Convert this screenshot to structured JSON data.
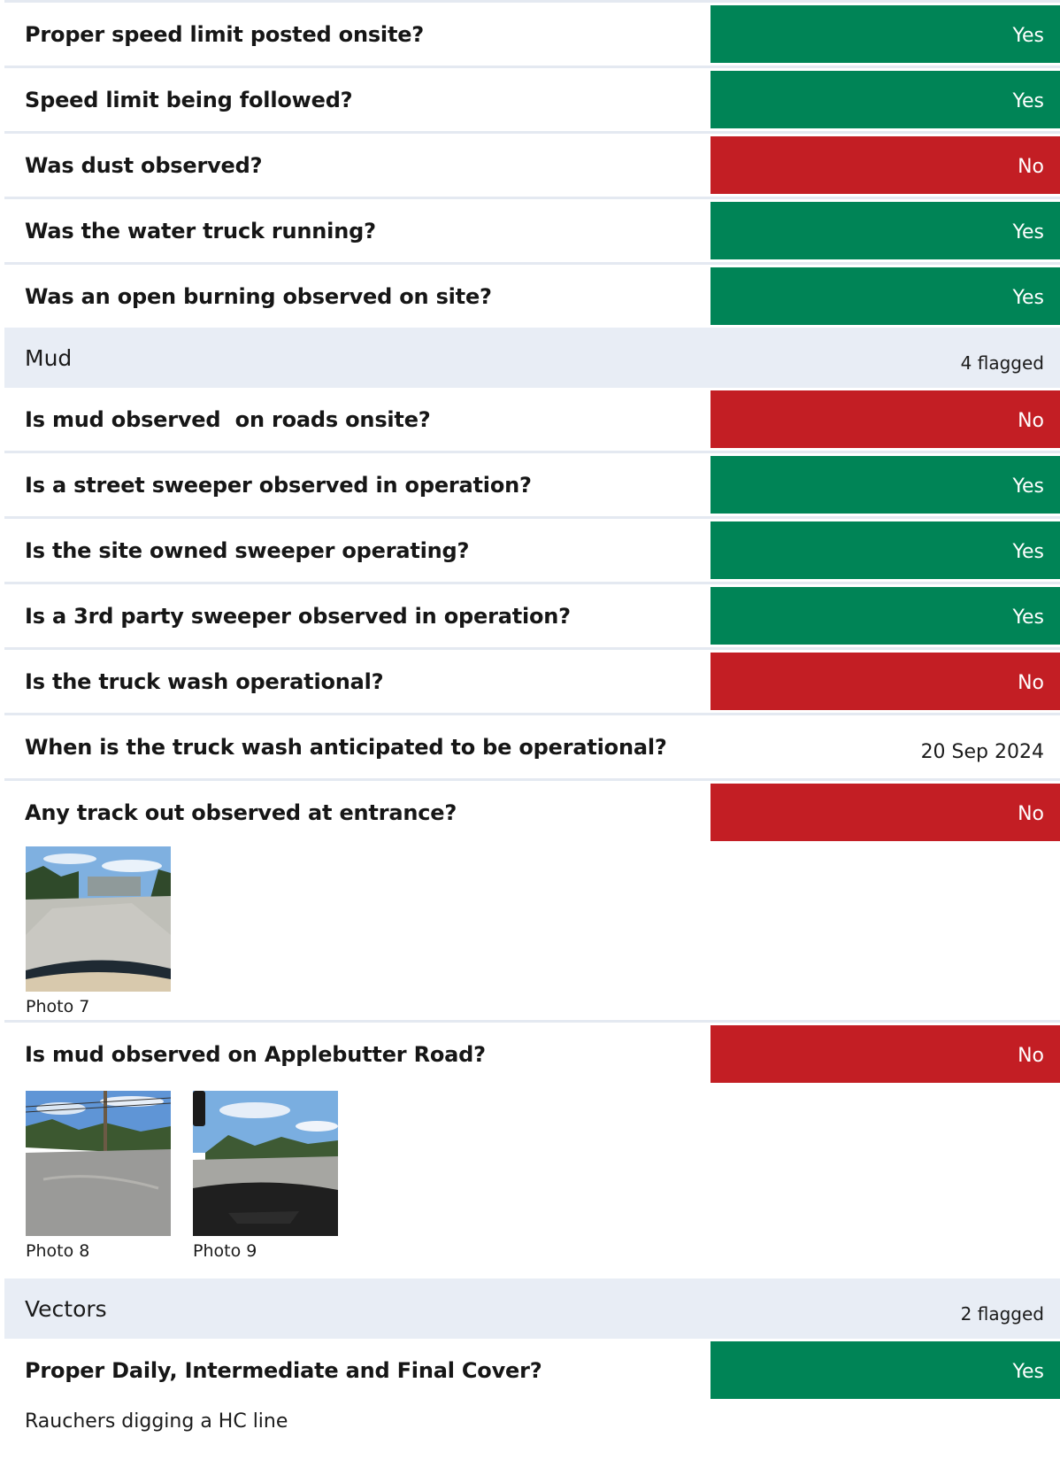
{
  "colors": {
    "yes": "#008456",
    "no": "#c31e24",
    "section_bg": "#e8edf5",
    "separator": "#e4e9f1"
  },
  "rows_a": [
    {
      "question": "Proper speed limit posted onsite?",
      "answer": "Yes"
    },
    {
      "question": "Speed limit being followed?",
      "answer": "Yes"
    },
    {
      "question": "Was dust observed?",
      "answer": "No"
    },
    {
      "question": "Was the water truck running?",
      "answer": "Yes"
    },
    {
      "question": "Was an open burning observed on site?",
      "answer": "Yes"
    }
  ],
  "section_mud": {
    "title": "Mud",
    "flag": "4 flagged"
  },
  "rows_b": [
    {
      "question": "Is mud observed  on roads onsite?",
      "answer": "No"
    },
    {
      "question": "Is a street sweeper observed in operation?",
      "answer": "Yes"
    },
    {
      "question": "Is the site owned sweeper operating?",
      "answer": "Yes"
    },
    {
      "question": "Is a 3rd party sweeper observed in operation?",
      "answer": "Yes"
    },
    {
      "question": "Is the truck wash operational?",
      "answer": "No"
    },
    {
      "question": "When is the truck wash anticipated to be operational?",
      "answer": "20 Sep 2024"
    },
    {
      "question": "Any track out observed at entrance?",
      "answer": "No"
    }
  ],
  "photos_track": [
    {
      "caption": "Photo 7"
    }
  ],
  "row_applebutter": {
    "question": "Is mud observed on Applebutter Road?",
    "answer": "No"
  },
  "photos_applebutter": [
    {
      "caption": "Photo 8"
    },
    {
      "caption": "Photo 9"
    }
  ],
  "section_vectors": {
    "title": "Vectors",
    "flag": "2 flagged"
  },
  "row_cover": {
    "question": "Proper Daily, Intermediate and Final Cover?",
    "answer": "Yes"
  },
  "note_cover": "Rauchers digging a HC line"
}
